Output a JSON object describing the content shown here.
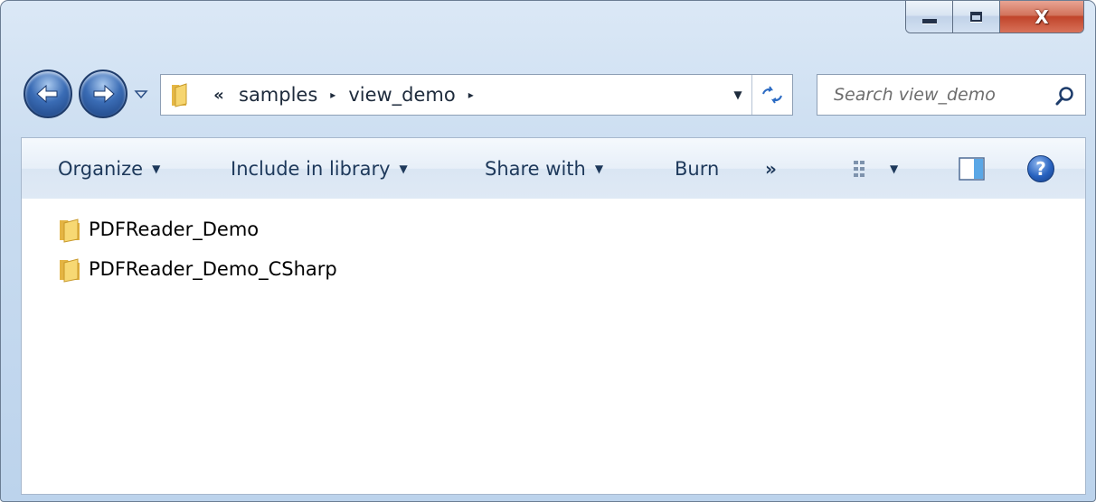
{
  "window": {
    "caption_buttons": {
      "minimize_icon": "minimize-icon",
      "maximize_icon": "maximize-icon",
      "close_label": "X"
    }
  },
  "navigation": {
    "back_icon": "back-arrow-icon",
    "forward_icon": "forward-arrow-icon",
    "recent_pages_icon": "chevron-down-icon"
  },
  "address_bar": {
    "overflow_label": "«",
    "breadcrumbs": [
      "samples",
      "view_demo"
    ],
    "separator": "▸",
    "dropdown_label": "▼"
  },
  "search": {
    "placeholder": "Search view_demo",
    "icon": "search-icon"
  },
  "command_bar": {
    "organize": "Organize",
    "include_in_library": "Include in library",
    "share_with": "Share with",
    "burn": "Burn",
    "more": "»",
    "caret": "▼",
    "help": "?"
  },
  "files": [
    {
      "name": "PDFReader_Demo",
      "icon": "folder-icon"
    },
    {
      "name": "PDFReader_Demo_CSharp",
      "icon": "folder-icon"
    }
  ],
  "colors": {
    "chrome_top": "#dbe8f6",
    "chrome_bottom": "#bcd3ec",
    "command_text": "#1e395b",
    "close_button": "#c0442a"
  }
}
